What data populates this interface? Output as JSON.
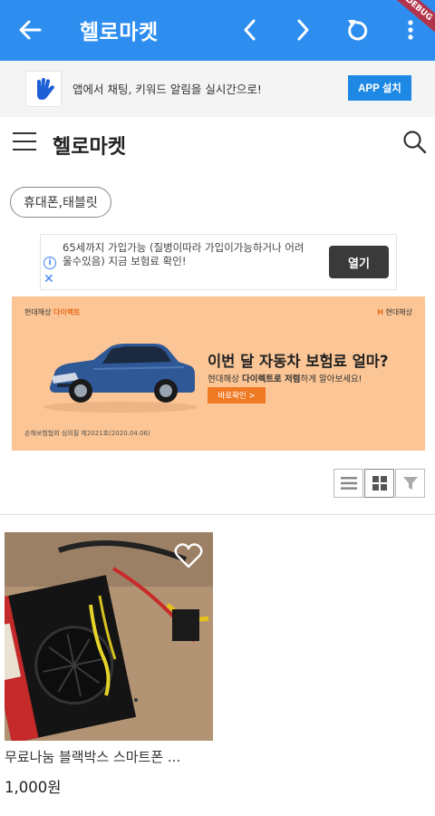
{
  "appbar": {
    "title": "헬로마켓",
    "debug_label": "DEBUG",
    "color": "#2e8ef0"
  },
  "app_banner": {
    "message": "앱에서 채팅, 키워드 알림을 실시간으로!",
    "install_label": "APP 설치"
  },
  "header": {
    "brand": "헬로마켓"
  },
  "category_chip": {
    "label": "휴대폰,태블릿"
  },
  "ad1": {
    "text": "65세까지 가입가능 (질병이따라 가입이가능하거나 어려울수있음) 지금 보험료 확인!",
    "open_label": "열기"
  },
  "ad2": {
    "brand_left_1": "현대해상",
    "brand_left_2": "다이렉트",
    "brand_right": "현대해상",
    "headline": "이번 달 자동차 보험료 얼마?",
    "sub_1": "현대해상 ",
    "sub_2": "다이렉트로 저렴",
    "sub_3": "하게 알아보세요!",
    "cta": "바로확인 >",
    "fine_print": "손해보험협회 심의필 제2021호(2020.04.06)",
    "background": "#fbc595"
  },
  "view_toggles": {
    "list": "list-view-icon",
    "grid": "grid-view-icon",
    "filter": "filter-icon"
  },
  "products": [
    {
      "title": "무료나눔 블랙박스 스마트폰 ...",
      "price": "1,000원",
      "favorite_icon": "heart-icon"
    }
  ]
}
